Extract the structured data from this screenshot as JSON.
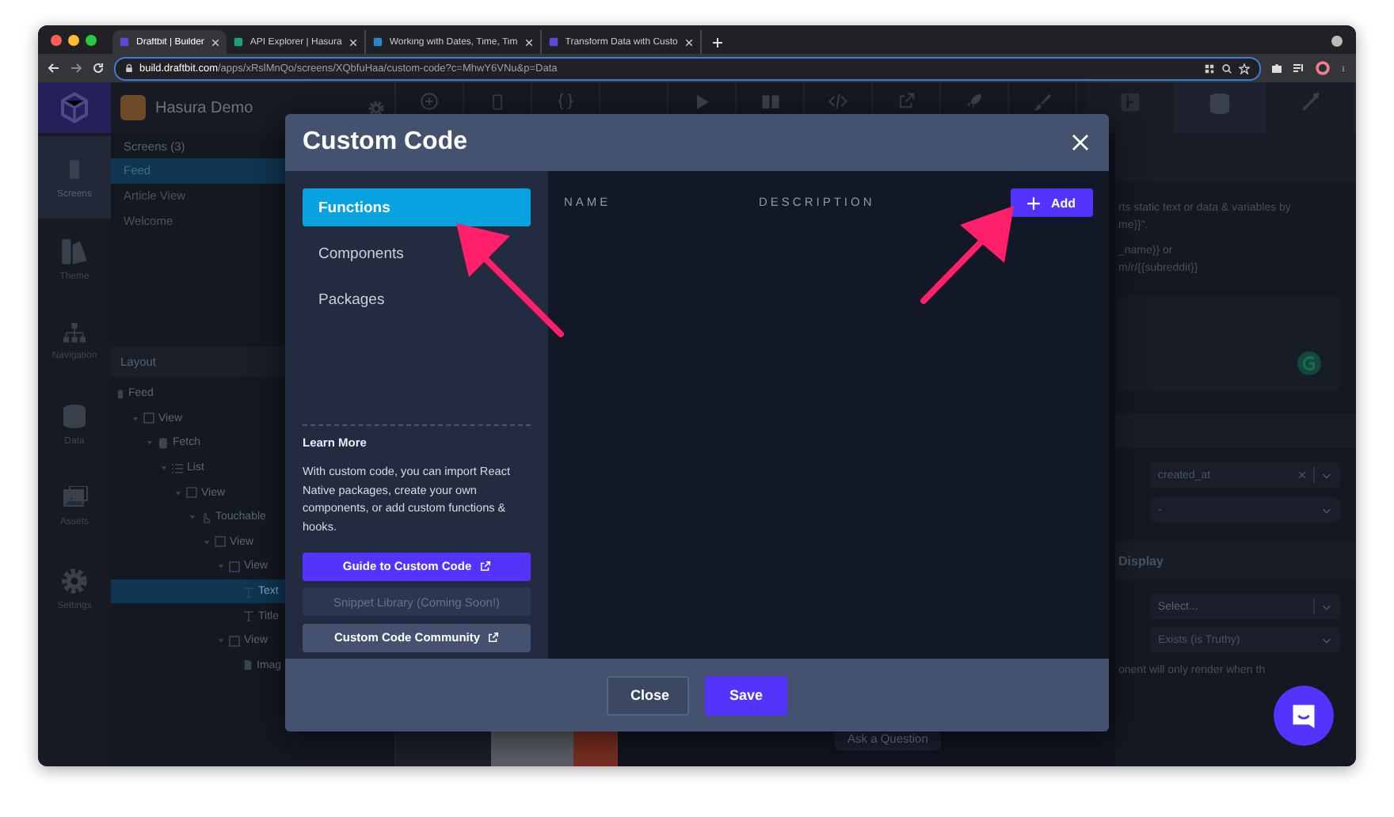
{
  "browser": {
    "tabs": [
      {
        "title": "Draftbit | Builder",
        "selected": true
      },
      {
        "title": "API Explorer | Hasura",
        "selected": false
      },
      {
        "title": "Working with Dates, Time, Tim",
        "selected": false
      },
      {
        "title": "Transform Data with Custo",
        "selected": false
      }
    ],
    "address": {
      "host": "build.draftbit.com",
      "path": "/apps/xRslMnQo/screens/XQbfuHaa/custom-code?c=MhwY6VNu&p=Data"
    }
  },
  "app": {
    "project": "Hasura Demo",
    "rail": [
      {
        "label": "Screens",
        "selected": true
      },
      {
        "label": "Theme",
        "selected": false
      },
      {
        "label": "Navigation",
        "selected": false
      },
      {
        "label": "Data",
        "selected": false
      },
      {
        "label": "Assets",
        "selected": false
      },
      {
        "label": "Settings",
        "selected": false
      }
    ],
    "screens": {
      "title": "Screens (3)",
      "items": [
        {
          "label": "Feed",
          "selected": true
        },
        {
          "label": "Article View",
          "selected": false
        },
        {
          "label": "Welcome",
          "selected": false
        }
      ]
    },
    "layout": {
      "title": "Layout",
      "tree": [
        {
          "label": "Feed",
          "kind": "screen",
          "selected": false,
          "children": [
            {
              "label": "View",
              "kind": "view",
              "selected": false,
              "children": [
                {
                  "label": "Fetch",
                  "kind": "fetch",
                  "selected": false,
                  "children": [
                    {
                      "label": "List",
                      "kind": "list",
                      "selected": false,
                      "children": [
                        {
                          "label": "View",
                          "kind": "view",
                          "selected": false,
                          "children": [
                            {
                              "label": "Touchable",
                              "kind": "touchable",
                              "selected": false,
                              "children": [
                                {
                                  "label": "View",
                                  "kind": "view",
                                  "selected": false,
                                  "children": [
                                    {
                                      "label": "View",
                                      "kind": "view",
                                      "selected": false,
                                      "children": [
                                        {
                                          "label": "Text",
                                          "kind": "text",
                                          "selected": true
                                        },
                                        {
                                          "label": "Title",
                                          "kind": "text",
                                          "selected": false
                                        }
                                      ]
                                    },
                                    {
                                      "label": "View",
                                      "kind": "view",
                                      "selected": false,
                                      "children": [
                                        {
                                          "label": "Imag",
                                          "kind": "image",
                                          "selected": false
                                        }
                                      ]
                                    }
                                  ]
                                }
                              ]
                            }
                          ]
                        }
                      ]
                    }
                  ]
                }
              ]
            }
          ]
        }
      ]
    },
    "right_panel": {
      "hint_lines": [
        "rts static text or data & variables by",
        "me}}\".",
        "_name}} or",
        "m/r/{{subreddit}}"
      ],
      "sort_field": {
        "value": "created_at"
      },
      "order_select": {
        "value": "-"
      },
      "display_section": "Display",
      "condition_select": {
        "placeholder": "Select..."
      },
      "operator_select": {
        "value": "Exists (is Truthy)"
      },
      "display_hint": "onent will only render when th"
    },
    "ask_button": "Ask a Question"
  },
  "modal": {
    "title": "Custom Code",
    "nav": [
      {
        "label": "Functions",
        "selected": true
      },
      {
        "label": "Components",
        "selected": false
      },
      {
        "label": "Packages",
        "selected": false
      }
    ],
    "learn_more": {
      "title": "Learn More",
      "text": "With custom code, you can import React Native packages, create your own components, or add custom functions & hooks."
    },
    "links": [
      {
        "label": "Guide to Custom Code",
        "kind": "primary",
        "disabled": false,
        "external": true
      },
      {
        "label": "Snippet Library (Coming Soon!)",
        "kind": "secondary",
        "disabled": true,
        "external": false
      },
      {
        "label": "Custom Code Community",
        "kind": "secondary",
        "disabled": false,
        "external": true
      }
    ],
    "columns": [
      "NAME",
      "DESCRIPTION"
    ],
    "add_button": "Add",
    "footer": {
      "close": "Close",
      "save": "Save"
    }
  }
}
